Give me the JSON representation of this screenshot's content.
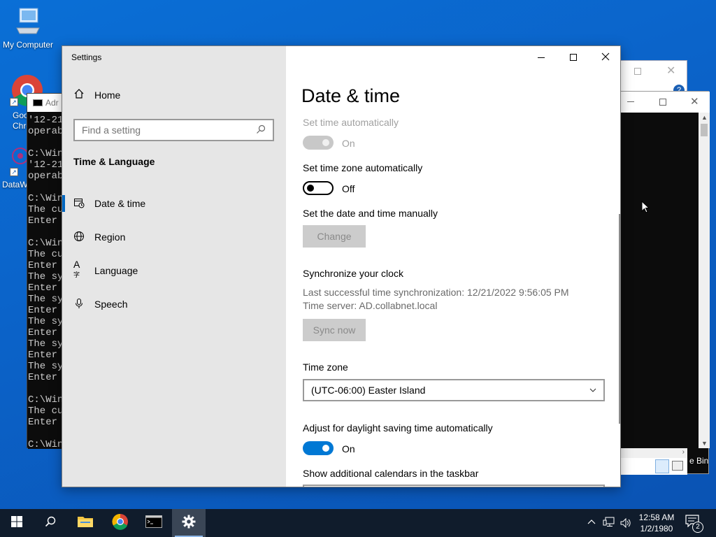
{
  "desktop": {
    "icons": [
      {
        "label": "My Computer",
        "icon": "computer-icon"
      },
      {
        "label": "Goo\nChro",
        "icon": "chrome-icon"
      },
      {
        "label": "DataW",
        "icon": "datawrapper-icon"
      }
    ],
    "recycle_partial": "e Bin"
  },
  "console": {
    "title_partial": "Adr",
    "lines": [
      "'12-21",
      "operab",
      "",
      "C:\\Win",
      "'12-21",
      "operab",
      "",
      "C:\\Win",
      "The cu",
      "Enter",
      "",
      "C:\\Win",
      "The cu",
      "Enter",
      "The sy",
      "Enter",
      "The sy",
      "Enter",
      "The sy",
      "Enter",
      "The sy",
      "Enter",
      "The sy",
      "Enter",
      "",
      "C:\\Win",
      "The cu",
      "Enter",
      "",
      "C:\\Win"
    ]
  },
  "settings": {
    "window_title": "Settings",
    "nav": {
      "home": "Home",
      "search_placeholder": "Find a setting",
      "section": "Time & Language",
      "items": [
        {
          "label": "Date & time",
          "icon": "clock-calendar-icon",
          "selected": true
        },
        {
          "label": "Region",
          "icon": "globe-icon",
          "selected": false
        },
        {
          "label": "Language",
          "icon": "language-icon",
          "selected": false
        },
        {
          "label": "Speech",
          "icon": "microphone-icon",
          "selected": false
        }
      ]
    },
    "page": {
      "title": "Date & time",
      "set_time_auto": {
        "label": "Set time automatically",
        "state": "On",
        "enabled": false
      },
      "set_tz_auto": {
        "label": "Set time zone automatically",
        "state": "Off"
      },
      "manual": {
        "label": "Set the date and time manually",
        "button": "Change"
      },
      "sync": {
        "heading": "Synchronize your clock",
        "last_sync": "Last successful time synchronization: 12/21/2022 9:56:05 PM",
        "server": "Time server: AD.collabnet.local",
        "button": "Sync now"
      },
      "time_zone": {
        "label": "Time zone",
        "value": "(UTC-06:00) Easter Island"
      },
      "dst": {
        "label": "Adjust for daylight saving time automatically",
        "state": "On"
      },
      "calendars": {
        "label": "Show additional calendars in the taskbar"
      }
    }
  },
  "taskbar": {
    "apps": [
      {
        "name": "start",
        "icon": "windows-start-icon"
      },
      {
        "name": "search",
        "icon": "search-icon"
      },
      {
        "name": "explorer",
        "icon": "folder-icon"
      },
      {
        "name": "chrome",
        "icon": "chrome-icon"
      },
      {
        "name": "cmd",
        "icon": "console-icon"
      },
      {
        "name": "settings",
        "icon": "gear-icon"
      }
    ],
    "time": "12:58 AM",
    "date": "1/2/1980",
    "notification_count": "2"
  }
}
